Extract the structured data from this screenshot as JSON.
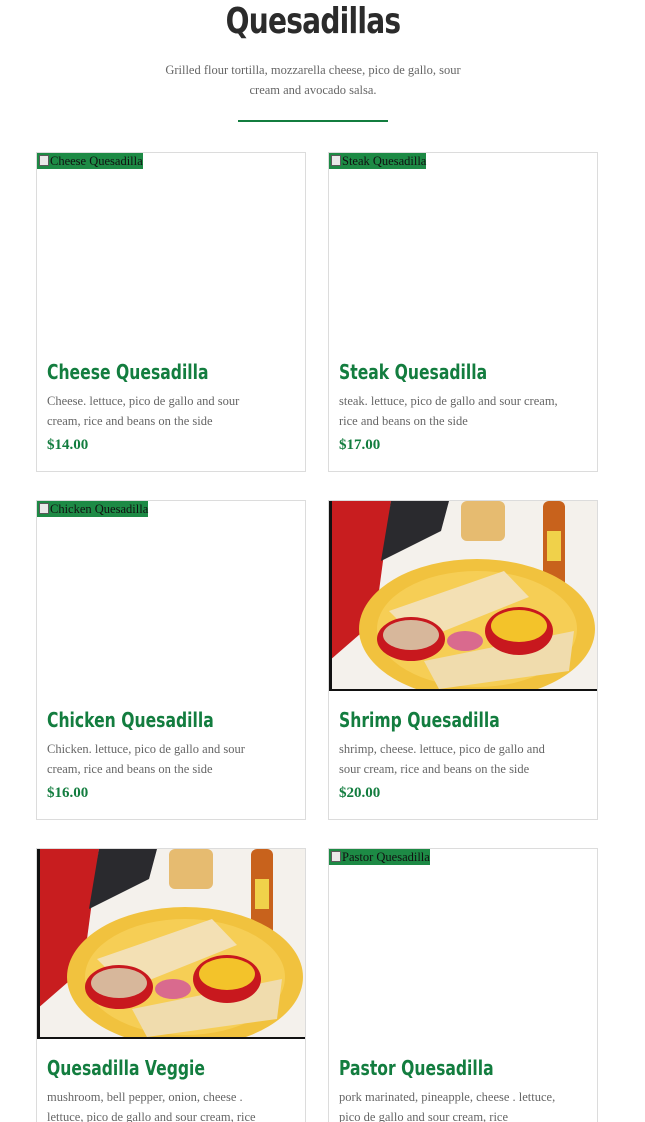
{
  "header": {
    "title": "Quesadillas",
    "description": "Grilled flour tortilla, mozzarella cheese, pico de gallo, sour cream and avocado salsa."
  },
  "colors": {
    "accent": "#137d3f",
    "broken_image_bg": "#1d8a45",
    "text_muted": "#666666",
    "title": "#2b2b2b"
  },
  "items": [
    {
      "name": "Cheese Quesadilla",
      "image_alt": "Cheese Quesadilla",
      "image_loaded": false,
      "description": "Cheese. lettuce, pico de gallo and sour cream, rice and beans on the side",
      "price": "$14.00"
    },
    {
      "name": "Steak Quesadilla",
      "image_alt": "Steak Quesadilla",
      "image_loaded": false,
      "description": "steak. lettuce, pico de gallo and sour cream, rice and beans on the side",
      "price": "$17.00"
    },
    {
      "name": "Chicken Quesadilla",
      "image_alt": "Chicken Quesadilla",
      "image_loaded": false,
      "description": "Chicken. lettuce, pico de gallo and sour cream, rice and beans on the side",
      "price": "$16.00"
    },
    {
      "name": "Shrimp Quesadilla",
      "image_alt": "Shrimp Quesadilla",
      "image_loaded": true,
      "description": "shrimp, cheese. lettuce, pico de gallo and sour cream, rice and beans on the side",
      "price": "$20.00"
    },
    {
      "name": "Quesadilla Veggie",
      "image_alt": "Quesadilla Veggie",
      "image_loaded": true,
      "description": "mushroom, bell pepper, onion, cheese . lettuce, pico de gallo and sour cream, rice",
      "price": ""
    },
    {
      "name": "Pastor Quesadilla",
      "image_alt": "Pastor Quesadilla",
      "image_loaded": false,
      "description": "pork marinated, pineapple, cheese . lettuce, pico de gallo and sour cream, rice",
      "price": ""
    }
  ]
}
